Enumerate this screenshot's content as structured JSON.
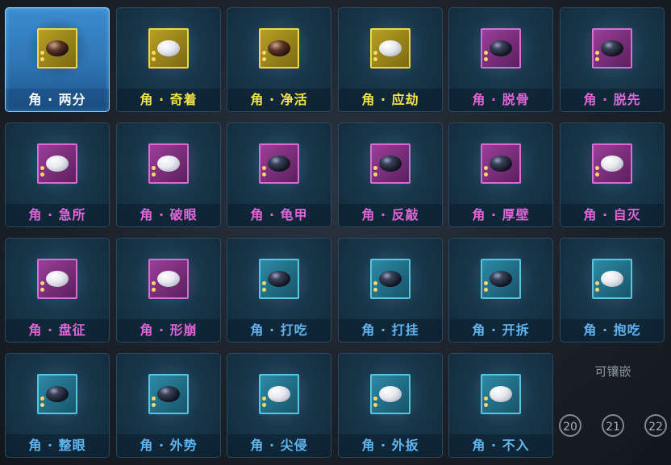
{
  "items": [
    {
      "label": "角 · 两分",
      "rarity": "gold",
      "stone": "brown",
      "selected": true
    },
    {
      "label": "角 · 奇着",
      "rarity": "gold",
      "stone": "white"
    },
    {
      "label": "角 · 净活",
      "rarity": "gold",
      "stone": "brown"
    },
    {
      "label": "角 · 应劫",
      "rarity": "gold",
      "stone": "white"
    },
    {
      "label": "角 · 脱骨",
      "rarity": "purple",
      "stone": "black"
    },
    {
      "label": "角 · 脱先",
      "rarity": "purple",
      "stone": "black"
    },
    {
      "label": "角 · 急所",
      "rarity": "purple",
      "stone": "white"
    },
    {
      "label": "角 · 破眼",
      "rarity": "purple",
      "stone": "white"
    },
    {
      "label": "角 · 龟甲",
      "rarity": "purple",
      "stone": "black"
    },
    {
      "label": "角 · 反敲",
      "rarity": "purple",
      "stone": "black"
    },
    {
      "label": "角 · 厚壁",
      "rarity": "purple",
      "stone": "black"
    },
    {
      "label": "角 · 自灭",
      "rarity": "purple",
      "stone": "white"
    },
    {
      "label": "角 · 盘征",
      "rarity": "purple",
      "stone": "white"
    },
    {
      "label": "角 · 形崩",
      "rarity": "purple",
      "stone": "white"
    },
    {
      "label": "角 · 打吃",
      "rarity": "blue",
      "stone": "black"
    },
    {
      "label": "角 · 打挂",
      "rarity": "blue",
      "stone": "black"
    },
    {
      "label": "角 · 开拆",
      "rarity": "blue",
      "stone": "black"
    },
    {
      "label": "角 · 抱吃",
      "rarity": "blue",
      "stone": "white"
    },
    {
      "label": "角 · 整眼",
      "rarity": "blue",
      "stone": "black"
    },
    {
      "label": "角 · 外势",
      "rarity": "blue",
      "stone": "black"
    },
    {
      "label": "角 · 尖侵",
      "rarity": "blue",
      "stone": "white"
    },
    {
      "label": "角 · 外扳",
      "rarity": "blue",
      "stone": "white"
    },
    {
      "label": "角 · 不入",
      "rarity": "blue",
      "stone": "white"
    }
  ],
  "background": {
    "socket_label": "可镶嵌",
    "page_numbers": [
      "20",
      "21",
      "22"
    ]
  },
  "colors": {
    "gold": "#f4e24a",
    "purple": "#e066d8",
    "blue": "#5fb5f0",
    "selected": "#ffffff"
  }
}
